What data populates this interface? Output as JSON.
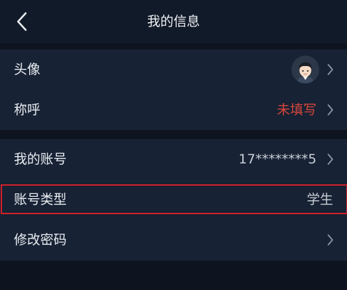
{
  "header": {
    "title": "我的信息",
    "back_icon": "chevron-left-icon"
  },
  "rows": [
    {
      "label": "头像",
      "value": "",
      "icon": "avatar"
    },
    {
      "label": "称呼",
      "value": "未填写"
    },
    {
      "label": "我的账号",
      "value": "17********5"
    },
    {
      "label": "账号类型",
      "value": "学生"
    },
    {
      "label": "修改密码",
      "value": ""
    }
  ],
  "colors": {
    "background": "#0d1420",
    "section": "#172234",
    "accent_red": "#d8473c",
    "highlight_border": "#d2202a"
  }
}
